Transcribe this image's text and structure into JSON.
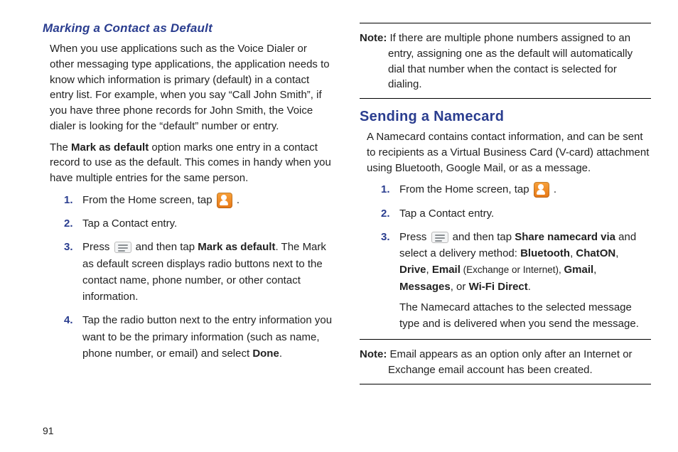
{
  "page_number": "91",
  "left": {
    "heading": "Marking a Contact as Default",
    "p1": "When you use applications such as the Voice Dialer or other messaging type applications, the application needs to know which information is primary (default) in a contact entry list. For example, when you say “Call John Smith”, if you have three phone records for John Smith, the Voice dialer is looking for the “default” number or entry.",
    "p2_a": "The ",
    "p2_bold": "Mark as default",
    "p2_b": " option marks one entry in a contact record to use as the default. This comes in handy when you have multiple entries for the same person.",
    "steps": {
      "s1_a": "From the Home screen, tap ",
      "s1_b": " .",
      "s2": "Tap a Contact entry.",
      "s3_a": "Press ",
      "s3_b": " and then tap ",
      "s3_bold": "Mark as default",
      "s3_c": ". The Mark as default screen displays radio buttons next to the contact name, phone number, or other contact information.",
      "s4_a": "Tap the radio button next to the entry information you want to be the primary information (such as name, phone number, or email) and select ",
      "s4_bold": "Done",
      "s4_b": "."
    }
  },
  "right": {
    "note1_label": "Note:",
    "note1_text": " If there are multiple phone numbers assigned to an entry, assigning one as the default will automatically dial that number when the contact is selected for dialing.",
    "heading": "Sending a Namecard",
    "p1": "A Namecard contains contact information, and can be sent to recipients as a Virtual Business Card (V-card) attachment using Bluetooth, Google Mail, or as a message.",
    "steps": {
      "s1_a": "From the Home screen, tap ",
      "s1_b": " .",
      "s2": "Tap a Contact entry.",
      "s3_a": "Press ",
      "s3_b": " and then tap ",
      "s3_bold1": "Share namecard via",
      "s3_c": " and select a delivery method: ",
      "s3_b1": "Bluetooth",
      "s3_sep": ", ",
      "s3_b2": "ChatON",
      "s3_b3": "Drive",
      "s3_b4": "Email",
      "s3_paren": " (Exchange or Internet), ",
      "s3_b5": "Gmail",
      "s3_b6": "Messages",
      "s3_or": ", or ",
      "s3_b7": "Wi-Fi Direct",
      "s3_end": ".",
      "s3_p2": "The Namecard attaches to the selected message type and is delivered when you send the message."
    },
    "note2_label": "Note:",
    "note2_text": " Email appears as an option only after an Internet or Exchange email account has been created."
  }
}
